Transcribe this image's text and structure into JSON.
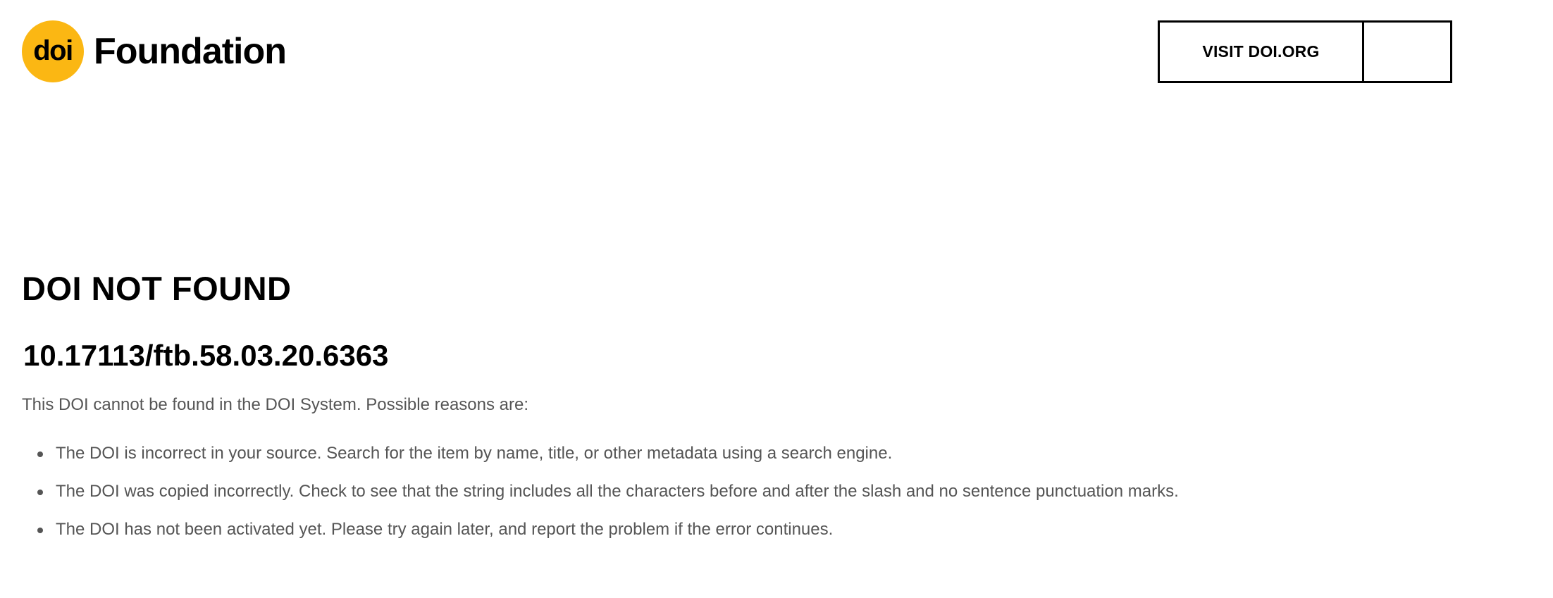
{
  "header": {
    "logo": {
      "mark_text": "doi",
      "wordmark": "Foundation",
      "accent_color": "#FBB713"
    },
    "visit_button_label": "VISIT DOI.ORG"
  },
  "main": {
    "title": "DOI NOT FOUND",
    "doi": "10.17113/ftb.58.03.20.6363",
    "intro": "This DOI cannot be found in the DOI System. Possible reasons are:",
    "reasons": [
      "The DOI is incorrect in your source. Search for the item by name, title, or other metadata using a search engine.",
      "The DOI was copied incorrectly. Check to see that the string includes all the characters before and after the slash and no sentence punctuation marks.",
      "The DOI has not been activated yet. Please try again later, and report the problem if the error continues."
    ]
  },
  "colors": {
    "text_primary": "#000000",
    "text_secondary": "#555555",
    "background": "#ffffff"
  }
}
